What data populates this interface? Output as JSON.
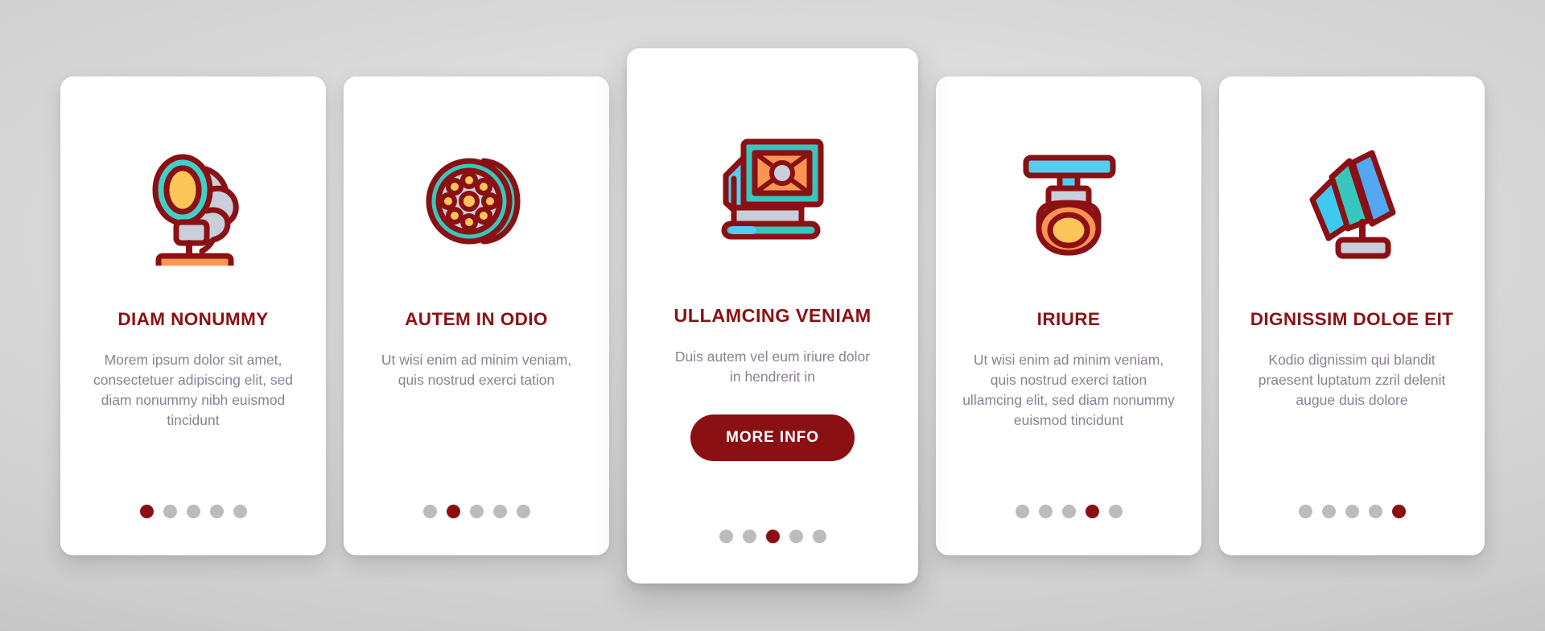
{
  "theme": {
    "accent": "#8B1013",
    "title_color": "#8E1013",
    "body_color": "#8b8192",
    "dot_inactive": "#bcbcbc",
    "card_bg": "#ffffff",
    "page_bg": "#cccccc"
  },
  "cards": [
    {
      "icon": "spotlight-on-base-icon",
      "title": "DIAM NONUMMY",
      "body": "Morem ipsum dolor sit amet, consectetuer adipiscing elit, sed diam nonummy nibh euismod tincidunt",
      "cta": null,
      "dots": {
        "count": 5,
        "active": 0
      }
    },
    {
      "icon": "ring-led-light-icon",
      "title": "AUTEM IN ODIO",
      "body": "Ut wisi enim ad minim veniam, quis nostrud exerci tation",
      "cta": null,
      "dots": {
        "count": 5,
        "active": 1
      }
    },
    {
      "icon": "softbox-panel-light-icon",
      "title": "ULLAMCING VENIAM",
      "body": "Duis autem vel eum iriure dolor in hendrerit in",
      "cta": "MORE INFO",
      "dots": {
        "count": 5,
        "active": 2
      }
    },
    {
      "icon": "ceiling-spotlight-icon",
      "title": "IRIURE",
      "body": "Ut wisi enim ad minim veniam, quis nostrud exerci tation ullamcing elit, sed diam nonummy euismod tincidunt",
      "cta": null,
      "dots": {
        "count": 5,
        "active": 3
      }
    },
    {
      "icon": "studio-light-stand-icon",
      "title": "DIGNISSIM DOLOE EIT",
      "body": "Kodio dignissim qui blandit praesent luptatum zzril delenit augue duis dolore",
      "cta": null,
      "dots": {
        "count": 5,
        "active": 4
      }
    }
  ]
}
